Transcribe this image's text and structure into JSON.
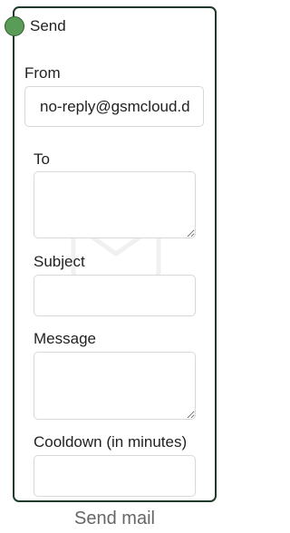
{
  "node": {
    "title": "Send",
    "footer_label": "Send mail",
    "border_color": "#1f3a2a",
    "port_color": "#5a9b57",
    "watermark_icon": "mail-envelope-icon"
  },
  "fields": {
    "from": {
      "label": "From",
      "value": "no-reply@gsmcloud.d"
    },
    "to": {
      "label": "To",
      "value": ""
    },
    "subject": {
      "label": "Subject",
      "value": ""
    },
    "message": {
      "label": "Message",
      "value": ""
    },
    "cooldown": {
      "label": "Cooldown (in minutes)",
      "value": ""
    }
  }
}
